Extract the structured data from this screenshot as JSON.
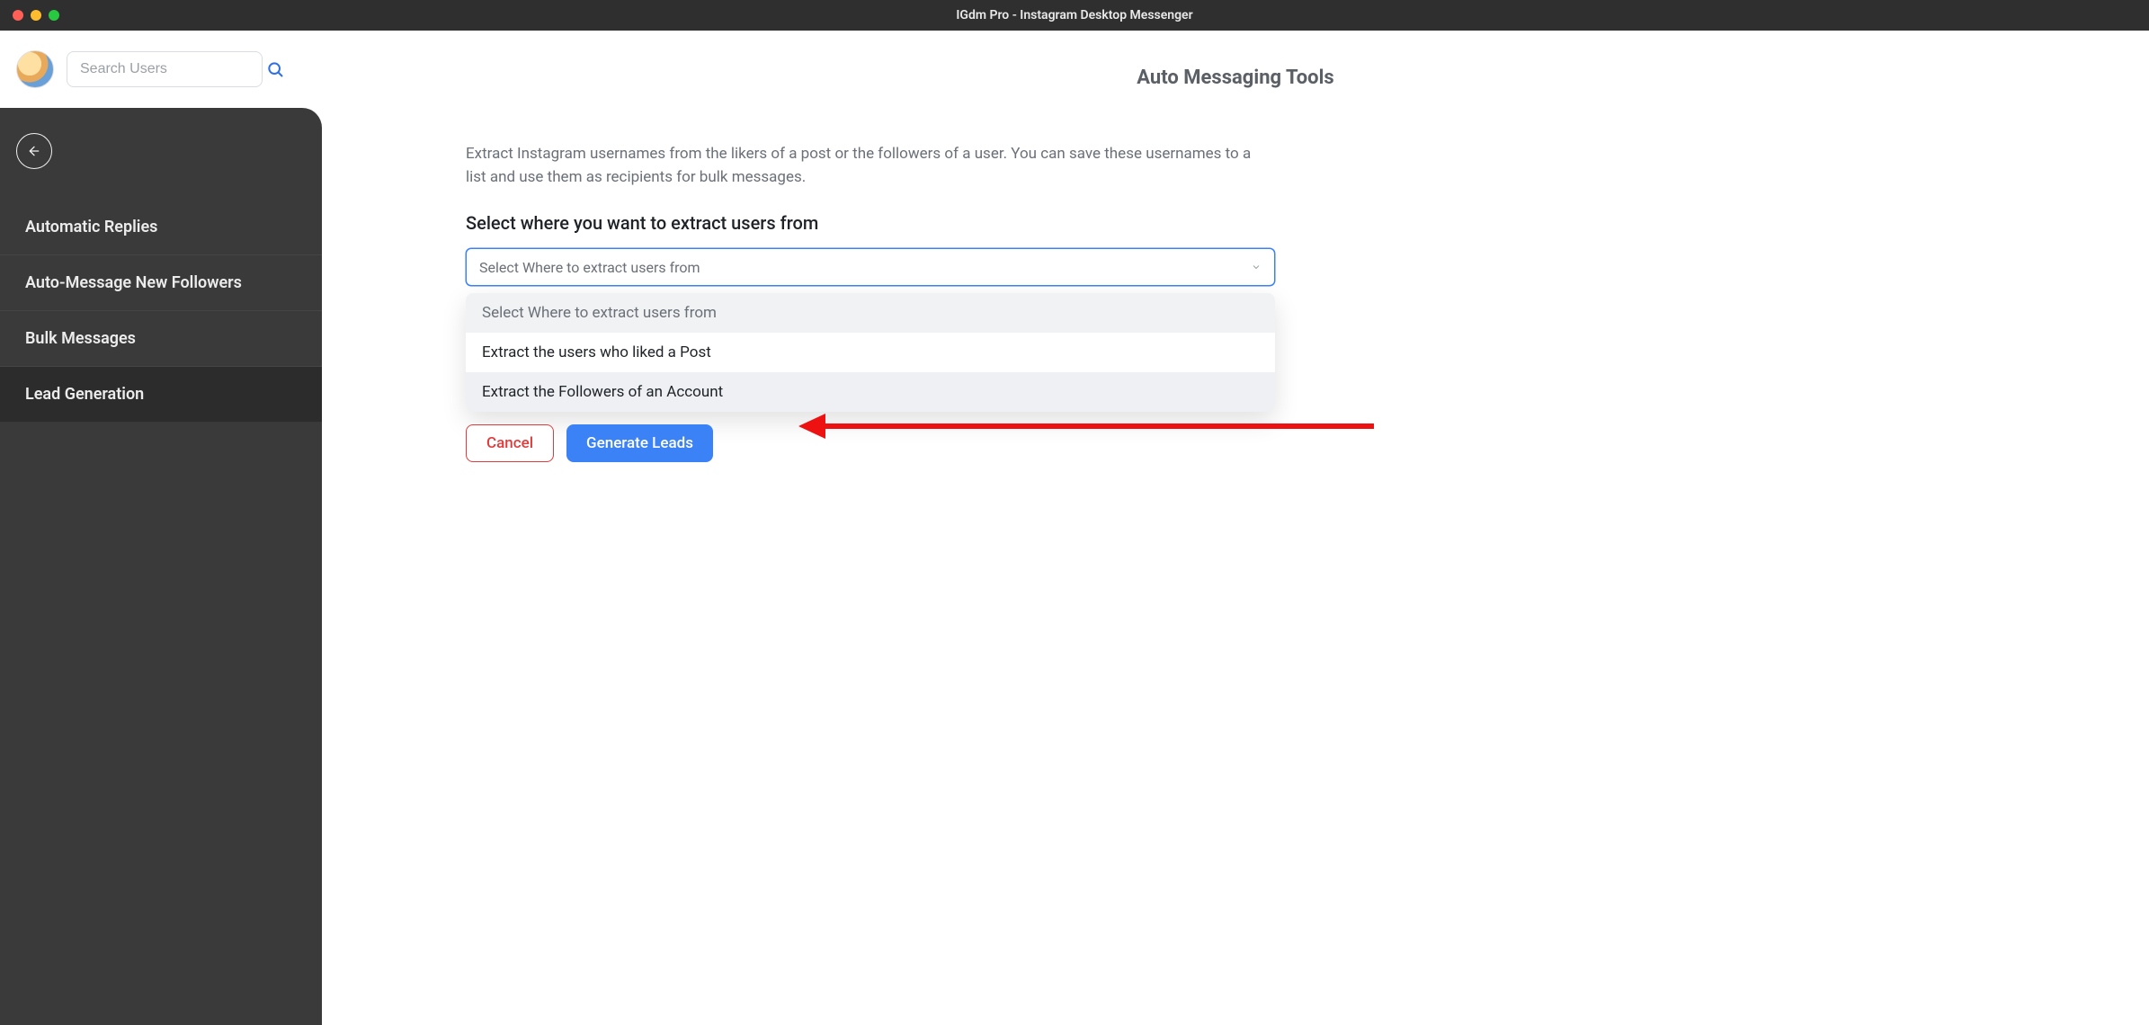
{
  "window": {
    "title": "IGdm Pro - Instagram Desktop Messenger"
  },
  "search": {
    "placeholder": "Search Users"
  },
  "sidebar": {
    "items": [
      {
        "label": "Automatic Replies"
      },
      {
        "label": "Auto-Message New Followers"
      },
      {
        "label": "Bulk Messages"
      },
      {
        "label": "Lead Generation"
      }
    ]
  },
  "main": {
    "title": "Auto Messaging Tools",
    "description": "Extract Instagram usernames from the likers of a post or the followers of a user. You can save these usernames to a list and use them as recipients for bulk messages.",
    "section_label": "Select where you want to extract users from",
    "select_placeholder": "Select Where to extract users from",
    "options": [
      "Select Where to extract users from",
      "Extract the users who liked a Post",
      "Extract the Followers of an Account"
    ],
    "cancel_label": "Cancel",
    "generate_label": "Generate Leads"
  },
  "colors": {
    "accent": "#3b82f6",
    "danger": "#e03b3b",
    "sidebar_bg": "#3a3a3a"
  }
}
